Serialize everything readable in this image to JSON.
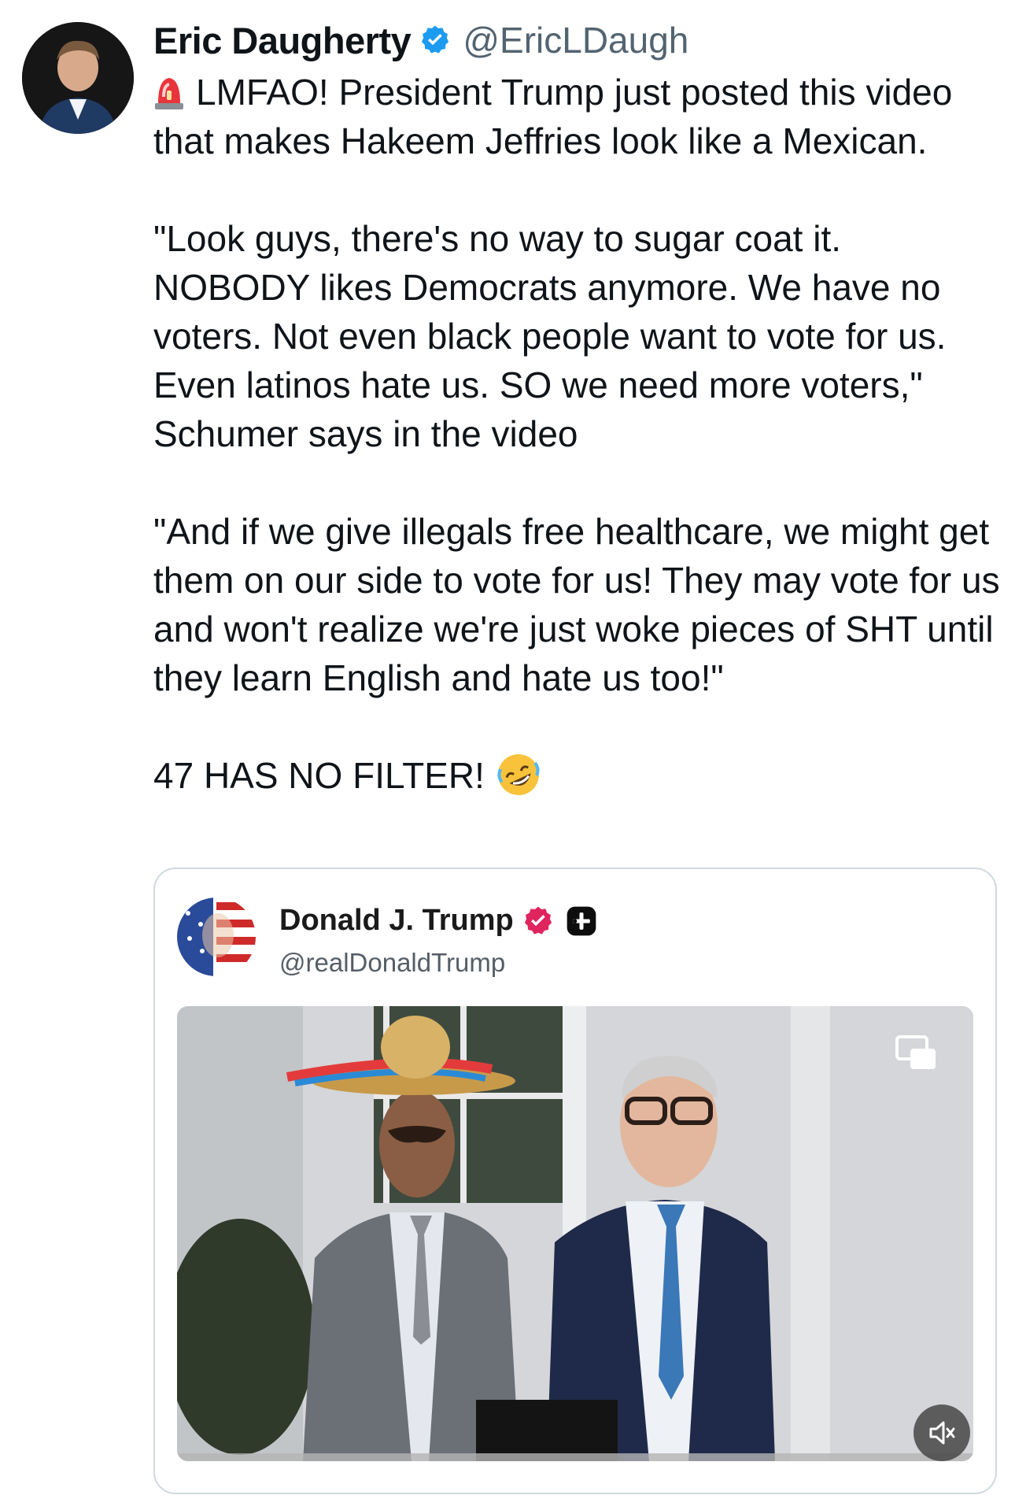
{
  "author": {
    "display_name": "Eric Daugherty",
    "handle": "@EricLDaugh",
    "avatar_icon": "profile-photo",
    "verified": true
  },
  "tweet": {
    "line1": "LMFAO! President Trump just posted this video that makes Hakeem Jeffries look like a Mexican.",
    "para2": "\"Look guys, there's no way to sugar coat it. NOBODY likes Democrats anymore. We have no voters. Not even black people want to vote for us. Even latinos hate us. SO we need more voters,\" Schumer says in the video",
    "para3": "\"And if we give illegals free healthcare, we might get them on our side to vote for us! They may vote for us and won't realize we're just woke pieces of SHT until they learn English and hate us too!\"",
    "para4": "47 HAS NO FILTER!",
    "emoji_lead": "siren-emoji",
    "emoji_trail": "rolling-laughing-emoji"
  },
  "quote": {
    "display_name": "Donald J. Trump",
    "handle": "@realDonaldTrump",
    "badge_color": "#e0245e",
    "video": {
      "has_pip_button": true,
      "muted": true,
      "progress": 0.92
    }
  },
  "colors": {
    "text": "#0f1419",
    "secondary": "#536471",
    "verified_blue": "#1d9bf0",
    "border": "#cfd9de"
  }
}
